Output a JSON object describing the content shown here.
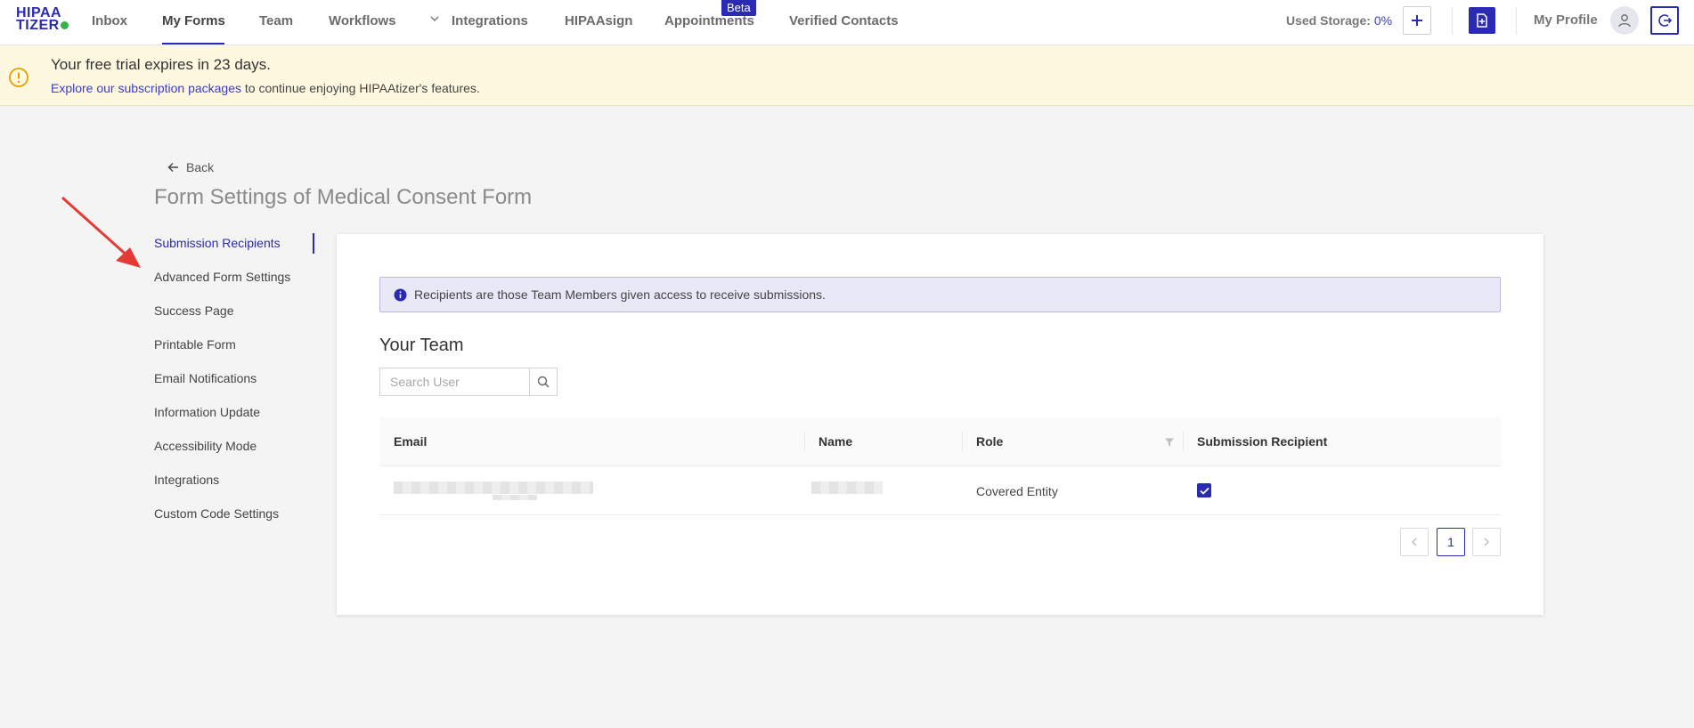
{
  "brand": {
    "logo_line1": "HIPAA",
    "logo_line2": "TIZER"
  },
  "nav": {
    "items": [
      {
        "label": "Inbox"
      },
      {
        "label": "My Forms"
      },
      {
        "label": "Team"
      },
      {
        "label": "Workflows"
      },
      {
        "label": "Integrations"
      },
      {
        "label": "HIPAAsign"
      },
      {
        "label": "Appointments"
      },
      {
        "label": "Verified Contacts"
      }
    ],
    "beta_badge": "Beta",
    "active": "My Forms"
  },
  "header": {
    "storage_label": "Used Storage:",
    "storage_value": "0%",
    "profile_label": "My Profile"
  },
  "banner": {
    "title": "Your free trial expires in 23 days.",
    "link_text": "Explore our subscription packages",
    "tail_text": " to continue enjoying HIPAAtizer's features."
  },
  "page": {
    "back_label": "Back",
    "title": "Form Settings of Medical Consent Form"
  },
  "sidemenu": {
    "items": [
      {
        "label": "Submission Recipients"
      },
      {
        "label": "Advanced Form Settings"
      },
      {
        "label": "Success Page"
      },
      {
        "label": "Printable Form"
      },
      {
        "label": "Email Notifications"
      },
      {
        "label": "Information Update"
      },
      {
        "label": "Accessibility Mode"
      },
      {
        "label": "Integrations"
      },
      {
        "label": "Custom Code Settings"
      }
    ],
    "active": "Submission Recipients"
  },
  "card": {
    "info_text": "Recipients are those Team Members given access to receive submissions.",
    "team_title": "Your Team",
    "search_placeholder": "Search User",
    "table": {
      "columns": [
        "Email",
        "Name",
        "Role",
        "Submission Recipient"
      ],
      "rows": [
        {
          "email": "",
          "name": "",
          "role": "Covered Entity",
          "submission_recipient": true
        }
      ]
    },
    "pagination": {
      "current_page": "1"
    }
  },
  "colors": {
    "accent": "#2a2ab3",
    "banner_bg": "#fff8e1",
    "arrow": "#e53935"
  }
}
